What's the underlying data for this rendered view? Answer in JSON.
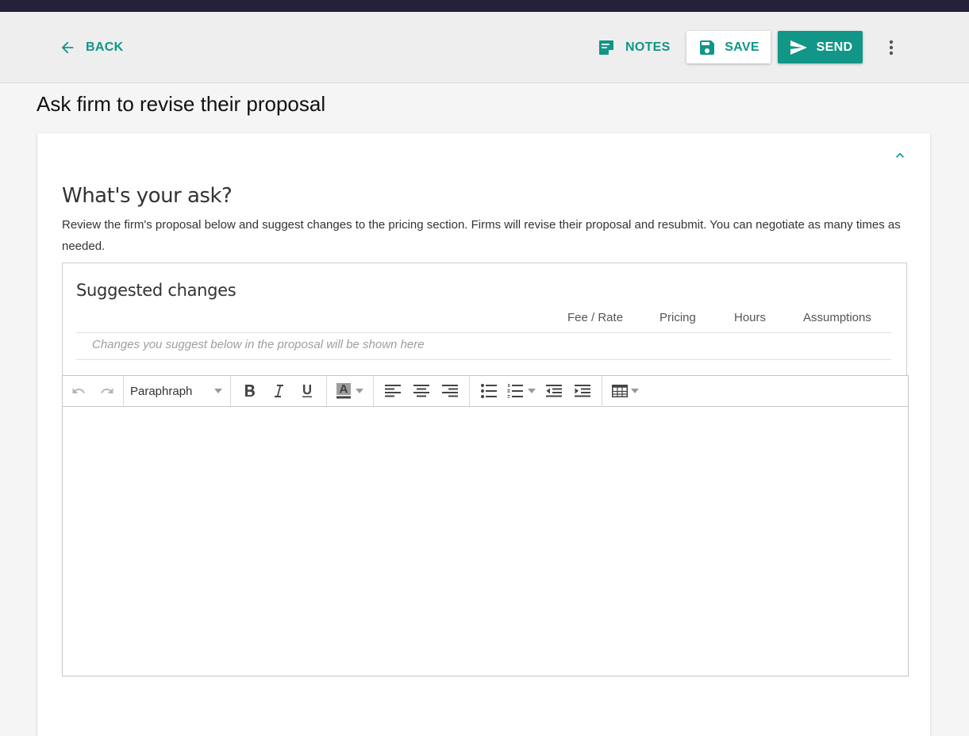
{
  "header": {
    "back_label": "BACK",
    "notes_label": "NOTES",
    "save_label": "SAVE",
    "send_label": "SEND"
  },
  "page": {
    "title": "Ask firm to revise their proposal"
  },
  "card": {
    "heading": "What's your ask?",
    "description": "Review the firm's proposal below and suggest changes to the pricing section. Firms will revise their proposal and resubmit. You can negotiate as many times as needed."
  },
  "changes": {
    "title": "Suggested changes",
    "columns": [
      "Fee / Rate",
      "Pricing",
      "Hours",
      "Assumptions"
    ],
    "placeholder": "Changes you suggest below in the proposal will be shown here"
  },
  "editor": {
    "block_format": "Paraphraph",
    "icons": [
      "undo-icon",
      "redo-icon",
      "bold-icon",
      "italic-icon",
      "underline-icon",
      "text-color-icon",
      "align-left-icon",
      "align-center-icon",
      "align-right-icon",
      "bullet-list-icon",
      "numbered-list-icon",
      "outdent-icon",
      "indent-icon",
      "table-icon"
    ]
  },
  "colors": {
    "accent": "#119688",
    "topstrip": "#25213a",
    "appbar": "#eeeeee"
  }
}
